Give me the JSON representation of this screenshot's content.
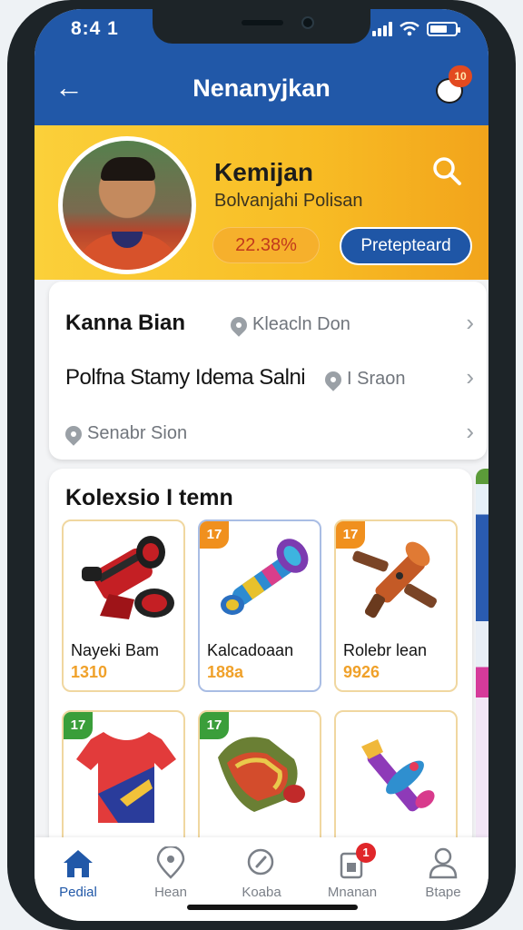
{
  "status_bar": {
    "time": "8:4 1"
  },
  "navbar": {
    "title": "Nenanyjkan",
    "mascot_badge": "10"
  },
  "profile": {
    "name": "Kemijan",
    "subtitle": "Bolvanjahi Polisan",
    "stat": "22.38%",
    "action_label": "Pretepteard"
  },
  "info_rows": [
    {
      "title": "Kanna Bian",
      "location": "Kleacln Don"
    },
    {
      "title": "Polfna Stamy Idema Salni",
      "location": "I Sraon"
    },
    {
      "title": "",
      "location": "Senabr Sion"
    }
  ],
  "collection": {
    "title": "Kolexsio I temn",
    "items": [
      {
        "badge": "",
        "name": "Nayeki Bam",
        "price": "1310",
        "icon": "horn-icon"
      },
      {
        "badge": "17",
        "name": "Kalcadoaan",
        "price": "188a",
        "icon": "drum-shaker-icon"
      },
      {
        "badge": "17",
        "name": "Rolebr lean",
        "price": "9926",
        "icon": "wooden-trumpet-icon"
      },
      {
        "badge": "17",
        "name": "",
        "price": "",
        "icon": "jersey-icon"
      },
      {
        "badge": "17",
        "name": "",
        "price": "",
        "icon": "scarf-icon"
      },
      {
        "badge": "",
        "name": "",
        "price": "",
        "icon": "rattle-icon"
      }
    ]
  },
  "bottom_nav": [
    {
      "label": "Pedial",
      "icon": "home-icon",
      "active": true
    },
    {
      "label": "Hean",
      "icon": "location-pin-icon",
      "active": false
    },
    {
      "label": "Koaba",
      "icon": "search-icon",
      "active": false
    },
    {
      "label": "Mnanan",
      "icon": "cart-icon",
      "active": false,
      "badge": "1"
    },
    {
      "label": "Btape",
      "icon": "profile-icon",
      "active": false
    }
  ],
  "colors": {
    "header_blue": "#2158a8",
    "profile_yellow": "#fbd03a",
    "price_orange": "#f0a12a",
    "badge_green": "#3a9e3a",
    "badge_orange": "#f0901e"
  }
}
